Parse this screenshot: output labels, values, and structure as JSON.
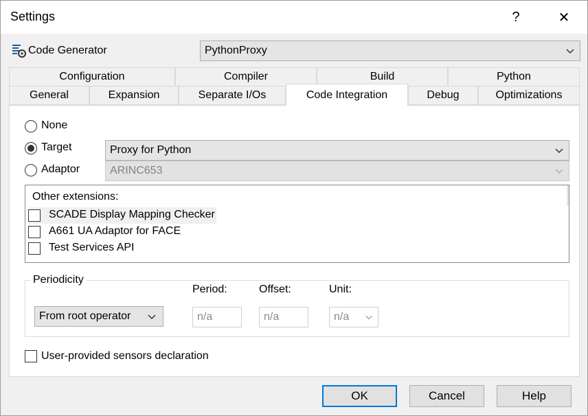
{
  "window": {
    "title": "Settings",
    "help_glyph": "?",
    "close_glyph": "✕"
  },
  "generator": {
    "label": "Code Generator",
    "selected": "PythonProxy"
  },
  "tabs_row1": [
    "Configuration",
    "Compiler",
    "Build",
    "Python"
  ],
  "tabs_row2": [
    "General",
    "Expansion",
    "Separate I/Os",
    "Code Integration",
    "Debug",
    "Optimizations"
  ],
  "integration": {
    "none_label": "None",
    "target_label": "Target",
    "adaptor_label": "Adaptor",
    "target_value": "Proxy for Python",
    "adaptor_value": "ARINC653",
    "selected": "Target"
  },
  "extensions": {
    "title": "Other extensions:",
    "items": [
      "SCADE Display Mapping Checker",
      "A661 UA Adaptor for FACE",
      "Test Services API"
    ]
  },
  "periodicity": {
    "title": "Periodicity",
    "mode": "From root operator",
    "period_label": "Period:",
    "offset_label": "Offset:",
    "unit_label": "Unit:",
    "period_value": "n/a",
    "offset_value": "n/a",
    "unit_value": "n/a"
  },
  "sensors_label": "User-provided sensors declaration",
  "buttons": {
    "ok": "OK",
    "cancel": "Cancel",
    "help": "Help"
  },
  "colors": {
    "accent": "#0078d7"
  }
}
